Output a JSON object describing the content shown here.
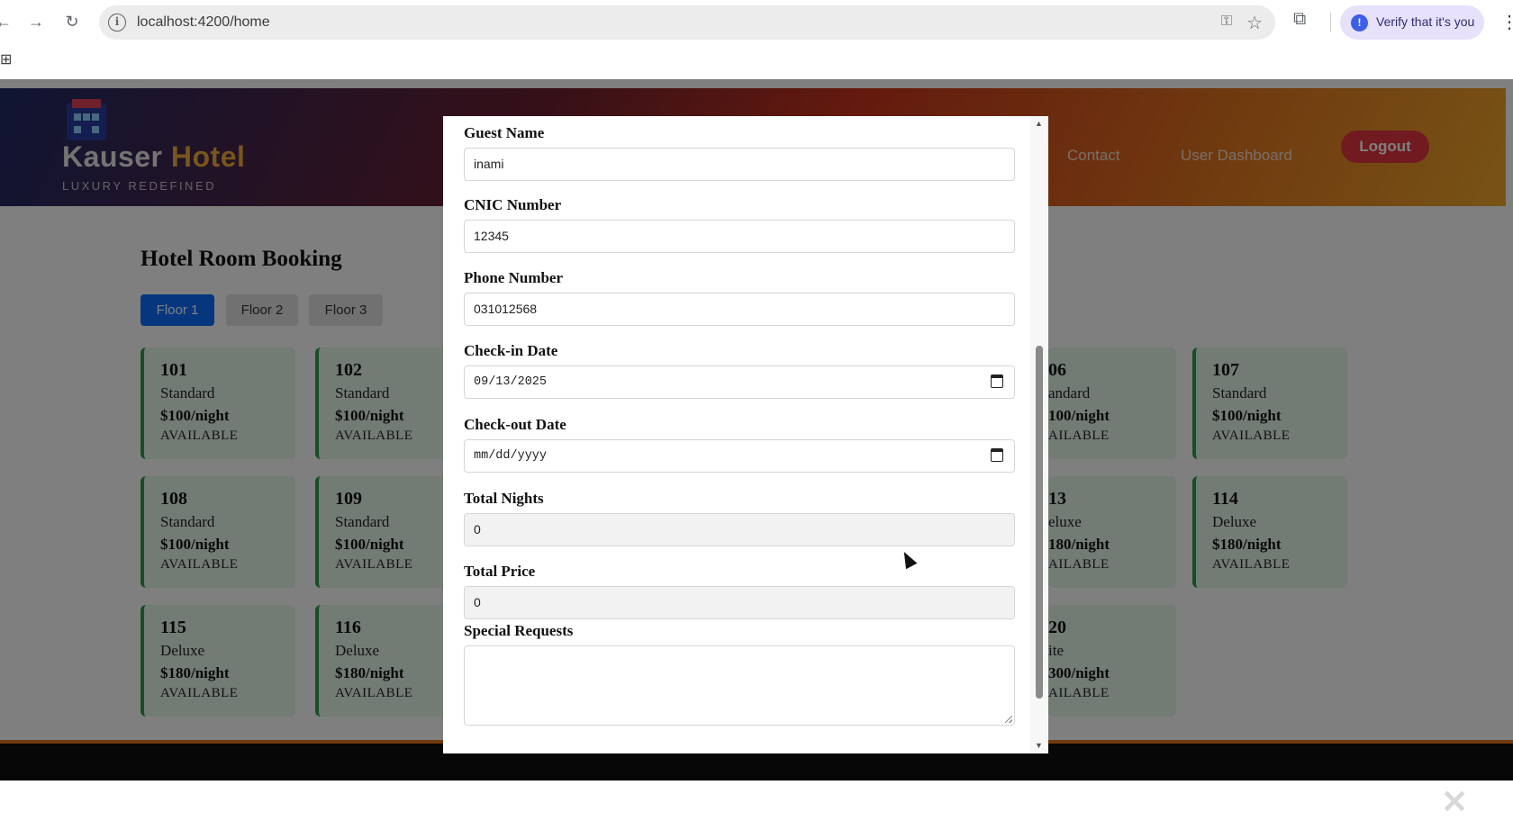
{
  "browser": {
    "url": "localhost:4200/home",
    "verify_label": "Verify that it's you"
  },
  "header": {
    "brand_first": "Kauser",
    "brand_second": "Hotel",
    "tagline": "LUXURY REDEFINED",
    "nav": [
      "Contact",
      "User Dashboard"
    ],
    "logout_label": "Logout"
  },
  "main": {
    "title": "Hotel Room Booking",
    "floors": [
      "Floor 1",
      "Floor 2",
      "Floor 3"
    ],
    "active_floor": "Floor 1",
    "rooms": [
      {
        "number": "101",
        "type": "Standard",
        "price": "$100/night",
        "status": "AVAILABLE"
      },
      {
        "number": "102",
        "type": "Standard",
        "price": "$100/night",
        "status": "AVAILABLE"
      },
      {
        "number": "06",
        "type": "andard",
        "price": "100/night",
        "status": "AILABLE"
      },
      {
        "number": "107",
        "type": "Standard",
        "price": "$100/night",
        "status": "AVAILABLE"
      },
      {
        "number": "108",
        "type": "Standard",
        "price": "$100/night",
        "status": "AVAILABLE"
      },
      {
        "number": "109",
        "type": "Standard",
        "price": "$100/night",
        "status": "AVAILABLE"
      },
      {
        "number": "13",
        "type": "eluxe",
        "price": "180/night",
        "status": "AILABLE"
      },
      {
        "number": "114",
        "type": "Deluxe",
        "price": "$180/night",
        "status": "AVAILABLE"
      },
      {
        "number": "115",
        "type": "Deluxe",
        "price": "$180/night",
        "status": "AVAILABLE"
      },
      {
        "number": "116",
        "type": "Deluxe",
        "price": "$180/night",
        "status": "AVAILABLE"
      },
      {
        "number": "20",
        "type": "ite",
        "price": "300/night",
        "status": "AILABLE"
      }
    ]
  },
  "modal": {
    "fields": {
      "guest_name": {
        "label": "Guest Name",
        "value": "inami"
      },
      "cnic": {
        "label": "CNIC Number",
        "value": "12345"
      },
      "phone": {
        "label": "Phone Number",
        "value": "031012568"
      },
      "checkin": {
        "label": "Check-in Date",
        "value": "09/13/2025"
      },
      "checkout": {
        "label": "Check-out Date",
        "value": "mm/dd/yyyy"
      },
      "nights": {
        "label": "Total Nights",
        "value": "0"
      },
      "price": {
        "label": "Total Price",
        "value": "0"
      },
      "requests": {
        "label": "Special Requests",
        "value": ""
      }
    }
  },
  "colors": {
    "primary": "#0d6efd",
    "logout": "#e3343e",
    "room_border": "#27a146",
    "room_bg": "#e6f6eb"
  }
}
